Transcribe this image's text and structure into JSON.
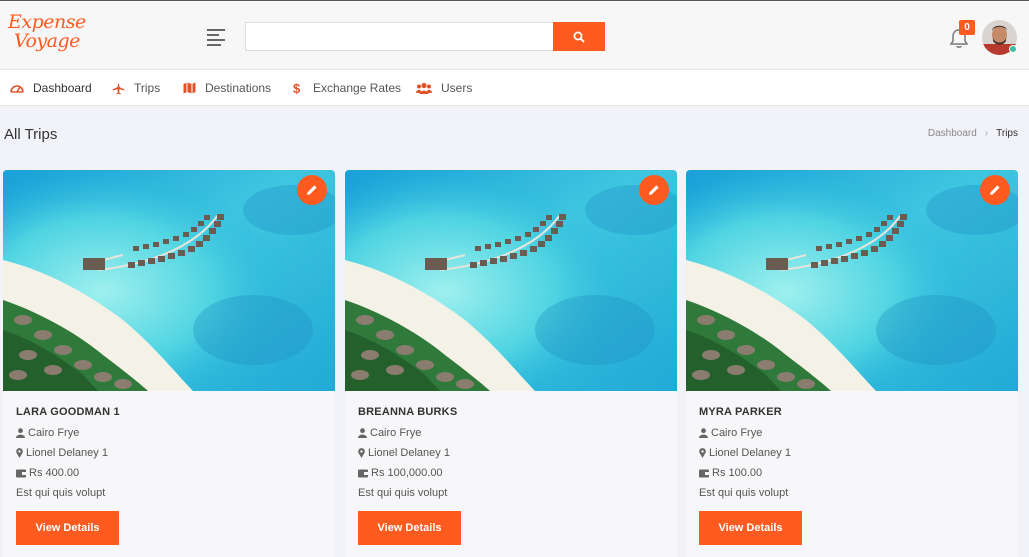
{
  "header": {
    "logo_line1": "Expense",
    "logo_line2": "Voyage",
    "search_value": "",
    "notification_count": "0",
    "accent_color": "#ff5a1f"
  },
  "nav": {
    "items": [
      {
        "label": "Dashboard",
        "icon": "dashboard-icon",
        "active": true
      },
      {
        "label": "Trips",
        "icon": "plane-icon"
      },
      {
        "label": "Destinations",
        "icon": "map-icon"
      },
      {
        "label": "Exchange Rates",
        "icon": "dollar-icon"
      },
      {
        "label": "Users",
        "icon": "users-icon"
      }
    ]
  },
  "page": {
    "title": "All Trips",
    "breadcrumb": [
      "Dashboard",
      "Trips"
    ]
  },
  "trips": [
    {
      "title": "LARA GOODMAN 1",
      "user": "Cairo Frye",
      "destination": "Lionel Delaney 1",
      "amount": "Rs 400.00",
      "description": "Est qui quis volupt",
      "button": "View Details"
    },
    {
      "title": "BREANNA BURKS",
      "user": "Cairo Frye",
      "destination": "Lionel Delaney 1",
      "amount": "Rs 100,000.00",
      "description": "Est qui quis volupt",
      "button": "View Details"
    },
    {
      "title": "MYRA PARKER",
      "user": "Cairo Frye",
      "destination": "Lionel Delaney 1",
      "amount": "Rs 100.00",
      "description": "Est qui quis volupt",
      "button": "View Details"
    }
  ]
}
